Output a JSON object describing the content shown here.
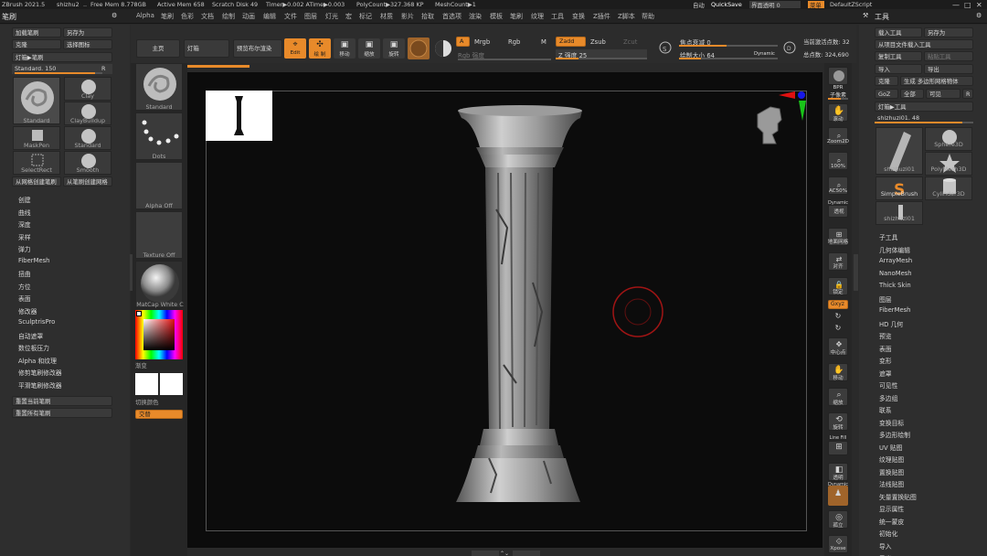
{
  "topbar": {
    "items": [
      "ZBrush 2021.5",
      "shizhu2",
      "..",
      "Free Mem 8.778GB",
      "Active Mem 658",
      "Scratch Disk 49",
      "Timer▶0.002 ATime▶0.003",
      "PolyCount▶327.368 KP",
      "MeshCount▶1"
    ],
    "right": [
      "自动",
      "QuickSave",
      "界面透明 0",
      "菜单",
      "DefaultZScript"
    ]
  },
  "left_title": "笔刷",
  "menubar": [
    "Alpha",
    "笔刷",
    "色彩",
    "文档",
    "绘制",
    "动画",
    "编辑",
    "文件",
    "图层",
    "灯光",
    "宏",
    "标记",
    "材质",
    "影片",
    "拾取",
    "首选项",
    "渲染",
    "模板",
    "笔刷",
    "纹理",
    "工具",
    "变换",
    "Z插件",
    "Z脚本",
    "帮助"
  ],
  "right_title": "工具",
  "brush_panel": {
    "load": "加载笔刷",
    "save_as": "另存为",
    "clone": "克隆",
    "select_icon": "选择图标",
    "lightbox": "灯箱▶笔刷",
    "standard_slider": "Standard. 150",
    "r": "R",
    "brushes": [
      "Standard",
      "Clay",
      "ClayBuildup",
      "MaskPen",
      "Standard",
      "SelectRect",
      "Smooth"
    ],
    "from_mesh": "从网格创建笔刷",
    "from_brush_mesh": "从笔刷创建网格",
    "menu": [
      "创建",
      "曲线",
      "深度",
      "采样",
      "弹力",
      "FiberMesh",
      "扭曲",
      "方位",
      "表面",
      "修改器",
      "SculptrisPro",
      "自动遮罩",
      "数位板压力",
      "Alpha 和纹理",
      "修剪笔刷修改器",
      "平滑笔刷修改器"
    ],
    "reset_current": "重置当前笔刷",
    "reset_all": "重置所有笔刷"
  },
  "shelf": [
    "Standard",
    "Dots",
    "Alpha Off",
    "Texture Off",
    "MatCap White C"
  ],
  "gradient": "渐变",
  "switch_color": "切换颜色",
  "alternate": "交替",
  "toolbar": {
    "home": "主页",
    "lightbox": "灯箱",
    "preview": "预览布尔渲染",
    "edit": "Edit",
    "draw": "绘 制",
    "move": "移动",
    "scale": "缩放",
    "rotate": "旋转",
    "a": "A",
    "mrgb": "Mrgb",
    "rgb": "Rgb",
    "m": "M",
    "rgb_strength": "Rgb 强度",
    "zadd": "Zadd",
    "zsub": "Zsub",
    "zcut": "Zcut",
    "z_intensity": "Z 强度 25",
    "focal": "焦点衰减 0",
    "draw_size": "绘制大小 64",
    "dynamic": "Dynamic",
    "active_points": "当前激活点数: 32",
    "total_points": "总点数: 324,690"
  },
  "right_shelf": [
    "BPR",
    "子像素",
    "滚动",
    "Zoom2D",
    "100%",
    "AC50%",
    "Dynamic",
    "透视",
    "地面网格",
    "对齐",
    "锁定",
    "Gxyz",
    "中心点",
    "移动",
    "缩放",
    "旋转",
    "Line Fill",
    "透明",
    "Dynamic",
    "孤立",
    "Xpose"
  ],
  "tool_panel": {
    "load": "载入工具",
    "save_as": "另存为",
    "from_project": "从项目文件载入工具",
    "copy": "复制工具",
    "paste": "粘贴工具",
    "import": "导入",
    "export": "导出",
    "clone": "克隆",
    "gen_poly": "生成 多边形网格物体",
    "goz": "GoZ",
    "all": "全部",
    "visible": "可见",
    "r": "R",
    "lightbox": "灯箱▶工具",
    "shizhu_slider": "shizhuzi01. 48",
    "tools": [
      "shizhuzi01",
      "Sphere3D",
      "PolyMesh3D",
      "SimpleBrush",
      "Cylinder3D",
      "shizhuzi01"
    ],
    "menu": [
      "子工具",
      "几何体编辑",
      "ArrayMesh",
      "NanoMesh",
      "Thick Skin",
      "图层",
      "FiberMesh",
      "HD 几何",
      "预览",
      "表面",
      "变形",
      "遮罩",
      "可见性",
      "多边组",
      "联系",
      "变换目标",
      "多边形绘制",
      "UV 贴图",
      "纹理贴图",
      "置换贴图",
      "法线贴图",
      "矢量置换贴图",
      "显示属性",
      "统一蒙皮",
      "初始化",
      "导入",
      "导出"
    ]
  },
  "colors": {
    "accent": "#e88a2a",
    "bg": "#2a2a2a",
    "canvas": "#0c0c0c"
  }
}
